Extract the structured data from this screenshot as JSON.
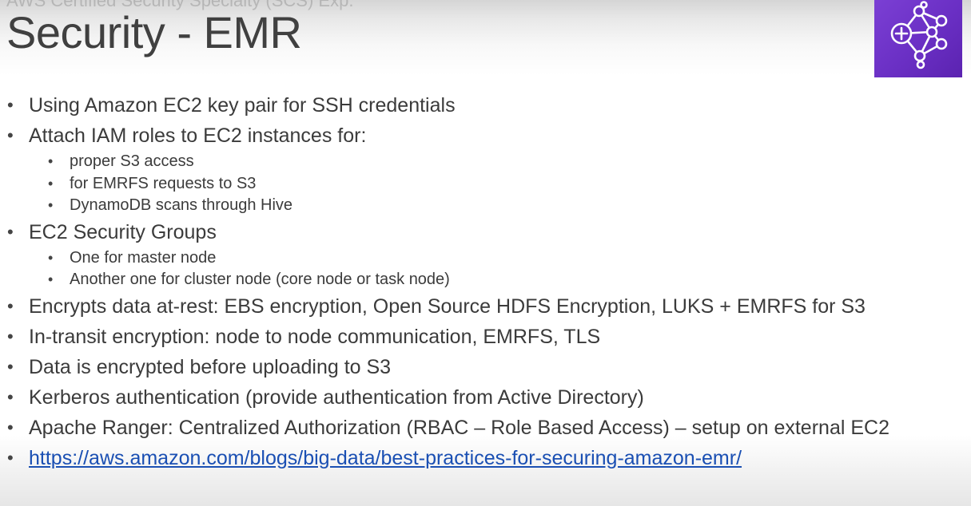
{
  "header": {
    "subtitle": "AWS Certified Security Specialty (SCS) Exp.",
    "title": "Security - EMR"
  },
  "logo": {
    "icon": "emr-cluster-network-icon",
    "color": "#6a2fc4"
  },
  "bullets": [
    {
      "text": "Using Amazon EC2 key pair for SSH credentials"
    },
    {
      "text": "Attach IAM roles to EC2 instances for:",
      "sub": [
        "proper S3 access",
        "for EMRFS requests to S3",
        "DynamoDB scans through Hive"
      ]
    },
    {
      "text": "EC2 Security Groups",
      "sub": [
        "One for master node",
        "Another one for cluster node (core node or task node)"
      ]
    },
    {
      "text": "Encrypts data at-rest: EBS encryption, Open Source HDFS Encryption, LUKS + EMRFS for S3"
    },
    {
      "text": "In-transit encryption: node to node communication, EMRFS, TLS"
    },
    {
      "text": "Data is encrypted before uploading to S3"
    },
    {
      "text": "Kerberos authentication (provide authentication from Active Directory)"
    },
    {
      "text": "Apache Ranger: Centralized Authorization (RBAC – Role Based Access) – setup on external EC2"
    },
    {
      "text": "https://aws.amazon.com/blogs/big-data/best-practices-for-securing-amazon-emr/",
      "link": true
    }
  ]
}
